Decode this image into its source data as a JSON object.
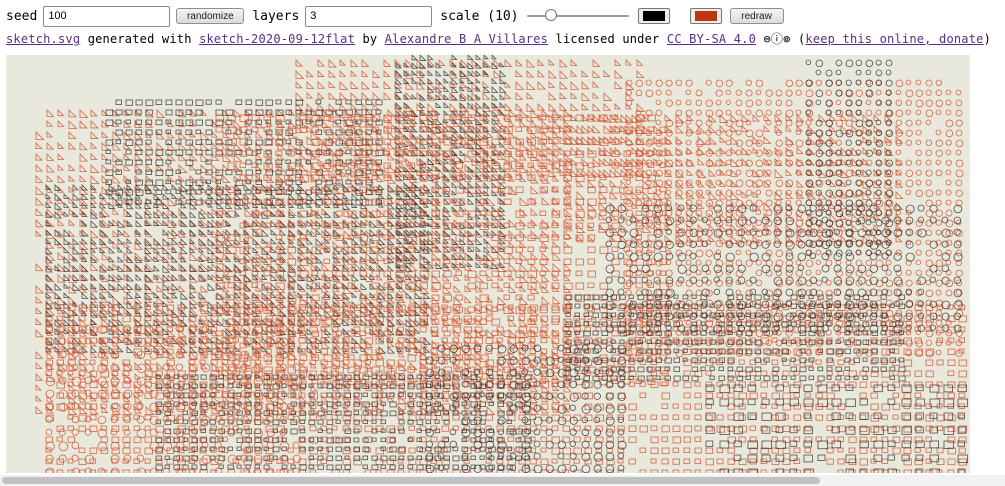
{
  "controls": {
    "seed_label": "seed",
    "seed_value": "100",
    "randomize_label": "randomize",
    "layers_label": "layers",
    "layers_value": "3",
    "scale_label": "scale (10)",
    "scale_level_fraction": 0.2,
    "color1": "#000000",
    "color2": "#c0360c",
    "redraw_label": "redraw"
  },
  "credit": {
    "file_link": "sketch.svg",
    "generated_with": "generated with",
    "sketch_link": "sketch-2020-09-12flat",
    "by": "by",
    "author_link": "Alexandre B A Villares",
    "licensed_under": "licensed under",
    "license_link": "CC BY-SA 4.0",
    "license_icons": "⊜ⓘ⊚",
    "paren_open": "(",
    "donate_link": "keep this online, donate",
    "paren_close": ")"
  },
  "canvas": {
    "background": "#e8e8dc",
    "ink_dark": "#1e1e1e",
    "ink_red": "#d2502a",
    "shape_types": [
      "triangle",
      "square",
      "circle"
    ]
  }
}
